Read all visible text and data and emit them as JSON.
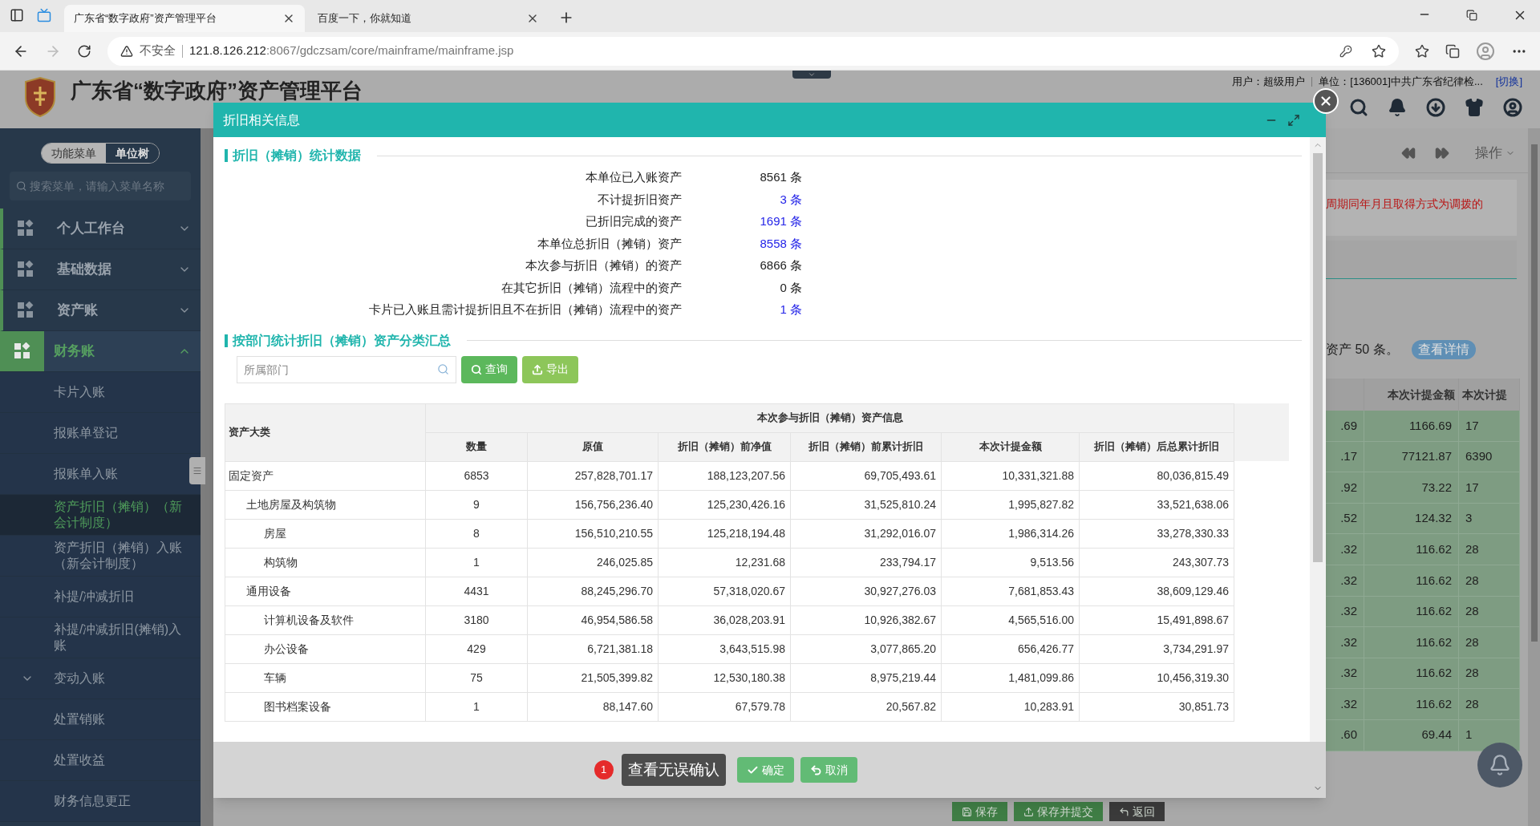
{
  "browser": {
    "tabs": [
      {
        "title": "广东省“数字政府”资产管理平台",
        "selected": true
      },
      {
        "title": "百度一下，你就知道",
        "selected": false
      }
    ],
    "security": "不安全",
    "url_host": "121.8.126.212",
    "url_rest": ":8067/gdczsam/core/mainframe/mainframe.jsp"
  },
  "header": {
    "title": "广东省“数字政府”资产管理平台",
    "user": "用户：超级用户",
    "unit": "单位：[136001]中共广东省纪律检...",
    "switch": "[切换]"
  },
  "sidebar": {
    "toggle": [
      {
        "label": "功能菜单",
        "selected": true
      },
      {
        "label": "单位树",
        "selected": false
      }
    ],
    "search_placeholder": "搜索菜单，请输入菜单名称",
    "items": [
      {
        "label": "个人工作台",
        "expanded": false,
        "selected": false
      },
      {
        "label": "基础数据",
        "expanded": false,
        "selected": false
      },
      {
        "label": "资产账",
        "expanded": false,
        "selected": false
      },
      {
        "label": "财务账",
        "expanded": true,
        "selected": true,
        "children": [
          {
            "label": "卡片入账",
            "kind": "link",
            "selected": false
          },
          {
            "label": "报账单登记",
            "kind": "link",
            "selected": false
          },
          {
            "label": "报账单入账",
            "kind": "link",
            "selected": false
          },
          {
            "label": "资产折旧（摊销）（新会计制度）",
            "kind": "link",
            "selected": true
          },
          {
            "label": "资产折旧（摊销）入账（新会计制度）",
            "kind": "link",
            "selected": false
          },
          {
            "label": "补提/冲减折旧",
            "kind": "link",
            "selected": false
          },
          {
            "label": "补提/冲减折旧(摊销)入账",
            "kind": "link",
            "selected": false
          },
          {
            "label": "变动入账",
            "kind": "folder",
            "selected": false
          },
          {
            "label": "处置销账",
            "kind": "link",
            "selected": false
          },
          {
            "label": "处置收益",
            "kind": "link",
            "selected": false
          },
          {
            "label": "财务信息更正",
            "kind": "link",
            "selected": false
          }
        ]
      }
    ]
  },
  "page_behind": {
    "action_menu": "操作",
    "notice": "周期同年月且取得方式为调拨的",
    "count_text": "资产 50 条。",
    "detail_button": "查看详情",
    "columns": [
      "",
      "本次计提金额",
      "本次计提"
    ],
    "rows": [
      [
        ".69",
        "1166.69",
        "17"
      ],
      [
        ".17",
        "77121.87",
        "6390"
      ],
      [
        ".92",
        "73.22",
        "17"
      ],
      [
        ".52",
        "124.32",
        "3"
      ],
      [
        ".32",
        "116.62",
        "28"
      ],
      [
        ".32",
        "116.62",
        "28"
      ],
      [
        ".32",
        "116.62",
        "28"
      ],
      [
        ".32",
        "116.62",
        "28"
      ],
      [
        ".32",
        "116.62",
        "28"
      ],
      [
        ".32",
        "116.62",
        "28"
      ],
      [
        ".60",
        "69.44",
        "1"
      ]
    ],
    "buttons": [
      "保存",
      "保存并提交",
      "返回"
    ]
  },
  "modal": {
    "title": "折旧相关信息",
    "stats_title": "折旧（摊销）统计数据",
    "stats": [
      {
        "label": "本单位已入账资产",
        "value": "8561 条",
        "link": false
      },
      {
        "label": "不计提折旧资产",
        "value": "3 条",
        "link": true
      },
      {
        "label": "已折旧完成的资产",
        "value": "1691 条",
        "link": true
      },
      {
        "label": "本单位总折旧（摊销）资产",
        "value": "8558 条",
        "link": true
      },
      {
        "label": "本次参与折旧（摊销）的资产",
        "value": "6866 条",
        "link": false
      },
      {
        "label": "在其它折旧（摊销）流程中的资产",
        "value": "0 条",
        "link": false
      },
      {
        "label": "卡片已入账且需计提折旧且不在折旧（摊销）流程中的资产",
        "value": "1 条",
        "link": true
      }
    ],
    "summary_title": "按部门统计折旧（摊销）资产分类汇总",
    "dept_placeholder": "所属部门",
    "query_button": "查询",
    "export_button": "导出",
    "table": {
      "first_column": "资产大类",
      "group_header": "本次参与折旧（摊销）资产信息",
      "columns": [
        "数量",
        "原值",
        "折旧（摊销）前净值",
        "折旧（摊销）前累计折旧",
        "本次计提金额",
        "折旧（摊销）后总累计折旧"
      ],
      "rows": [
        {
          "name": "固定资产",
          "values": [
            "6853",
            "257,828,701.17",
            "188,123,207.56",
            "69,705,493.61",
            "10,331,321.88",
            "80,036,815.49"
          ],
          "children": [
            {
              "name": "土地房屋及构筑物",
              "values": [
                "9",
                "156,756,236.40",
                "125,230,426.16",
                "31,525,810.24",
                "1,995,827.82",
                "33,521,638.06"
              ],
              "children": [
                {
                  "name": "房屋",
                  "values": [
                    "8",
                    "156,510,210.55",
                    "125,218,194.48",
                    "31,292,016.07",
                    "1,986,314.26",
                    "33,278,330.33"
                  ]
                },
                {
                  "name": "构筑物",
                  "values": [
                    "1",
                    "246,025.85",
                    "12,231.68",
                    "233,794.17",
                    "9,513.56",
                    "243,307.73"
                  ]
                }
              ]
            },
            {
              "name": "通用设备",
              "values": [
                "4431",
                "88,245,296.70",
                "57,318,020.67",
                "30,927,276.03",
                "7,681,853.43",
                "38,609,129.46"
              ],
              "children": [
                {
                  "name": "计算机设备及软件",
                  "values": [
                    "3180",
                    "46,954,586.58",
                    "36,028,203.91",
                    "10,926,382.67",
                    "4,565,516.00",
                    "15,491,898.67"
                  ]
                },
                {
                  "name": "办公设备",
                  "values": [
                    "429",
                    "6,721,381.18",
                    "3,643,515.98",
                    "3,077,865.20",
                    "656,426.77",
                    "3,734,291.97"
                  ]
                },
                {
                  "name": "车辆",
                  "values": [
                    "75",
                    "21,505,399.82",
                    "12,530,180.38",
                    "8,975,219.44",
                    "1,481,099.86",
                    "10,456,319.30"
                  ]
                },
                {
                  "name": "图书档案设备",
                  "values": [
                    "1",
                    "88,147.60",
                    "67,579.78",
                    "20,567.82",
                    "10,283.91",
                    "30,851.73"
                  ]
                }
              ]
            }
          ]
        }
      ]
    },
    "footer": {
      "badge": "1",
      "tooltip": "查看无误确认",
      "confirm": "确定",
      "cancel": "取消"
    }
  }
}
